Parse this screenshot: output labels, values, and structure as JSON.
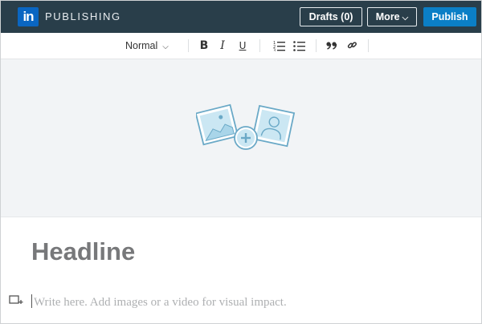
{
  "app": {
    "logo_text": "in",
    "brand": "PUBLISHING"
  },
  "header": {
    "drafts_label": "Drafts (0)",
    "more_label": "More",
    "publish_label": "Publish"
  },
  "toolbar": {
    "style_value": "Normal",
    "bold": "B",
    "italic": "I",
    "underline": "U"
  },
  "editor": {
    "headline_placeholder": "Headline",
    "body_placeholder": "Write here. Add images or a video for visual impact."
  },
  "colors": {
    "topbar": "#293e4a",
    "publish": "#0b7fc6",
    "brand_blue": "#0a66c2"
  },
  "icons": {
    "cover": "add-cover-image-icon",
    "ordered_list": "ordered-list-icon",
    "bullet_list": "bullet-list-icon",
    "quote": "quote-icon",
    "link": "link-icon",
    "add_media": "add-media-icon"
  }
}
